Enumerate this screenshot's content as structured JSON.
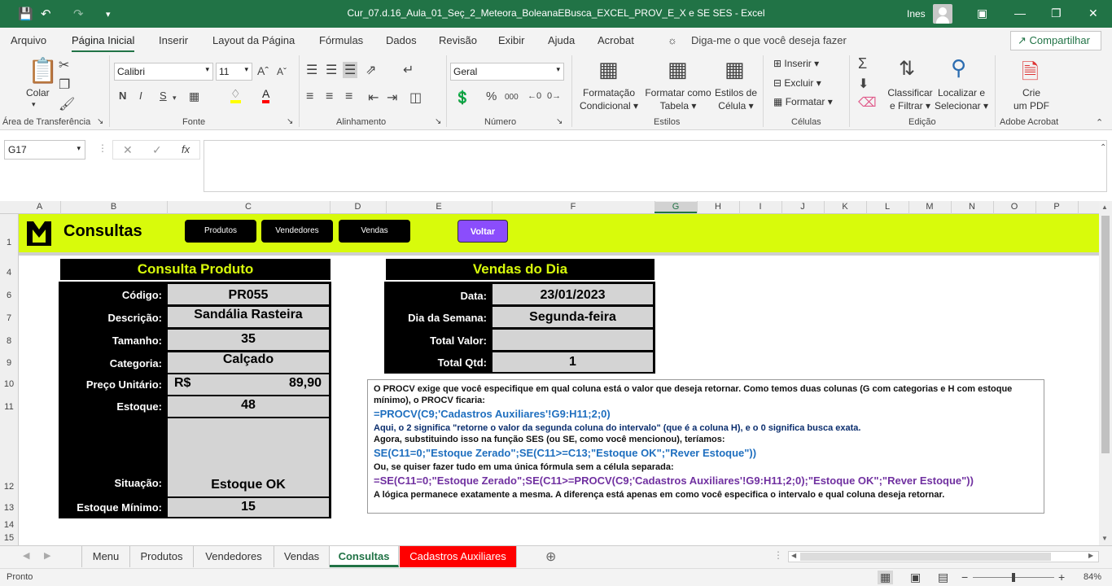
{
  "titlebar": {
    "filename": "Cur_07.d.16_Aula_01_Seç_2_Meteora_BoleanaEBusca_EXCEL_PROV_E_X e SE SES",
    "app": "Excel",
    "user": "Ines"
  },
  "menu": {
    "tabs": [
      "Arquivo",
      "Página Inicial",
      "Inserir",
      "Layout da Página",
      "Fórmulas",
      "Dados",
      "Revisão",
      "Exibir",
      "Ajuda",
      "Acrobat"
    ],
    "tellme": "Diga-me o que você deseja fazer",
    "share": "Compartilhar"
  },
  "ribbon": {
    "clipboard": {
      "paste": "Colar",
      "group": "Área de Transferência"
    },
    "font": {
      "name": "Calibri",
      "size": "11",
      "bold": "N",
      "italic": "I",
      "underline": "S",
      "group": "Fonte"
    },
    "alignment": {
      "group": "Alinhamento"
    },
    "number": {
      "format": "Geral",
      "percent": "%",
      "thousands": "000",
      "group": "Número"
    },
    "styles": {
      "cond1": "Formatação",
      "cond2": "Condicional",
      "table1": "Formatar como",
      "table2": "Tabela",
      "cell1": "Estilos de",
      "cell2": "Célula",
      "group": "Estilos"
    },
    "cells": {
      "insert": "Inserir",
      "delete": "Excluir",
      "format": "Formatar",
      "group": "Células"
    },
    "editing": {
      "sort1": "Classificar",
      "sort2": "e Filtrar",
      "find1": "Localizar e",
      "find2": "Selecionar",
      "group": "Edição"
    },
    "acrobat": {
      "pdf1": "Crie",
      "pdf2": "um PDF",
      "group": "Adobe Acrobat"
    }
  },
  "formula": {
    "namebox": "G17",
    "content": ""
  },
  "columns": [
    "A",
    "B",
    "C",
    "D",
    "E",
    "F",
    "G",
    "H",
    "I",
    "J",
    "K",
    "L",
    "M",
    "N",
    "O",
    "P"
  ],
  "rows": [
    "1",
    "4",
    "6",
    "7",
    "8",
    "9",
    "10",
    "11",
    "12",
    "13",
    "14",
    "15"
  ],
  "banner": {
    "title": "Consultas",
    "buttons": [
      "Produtos",
      "Vendedores",
      "Vendas"
    ],
    "back": "Voltar"
  },
  "produto": {
    "header": "Consulta Produto",
    "codigo_lbl": "Código:",
    "codigo": "PR055",
    "desc_lbl": "Descrição:",
    "desc": "Sandália Rasteira",
    "tam_lbl": "Tamanho:",
    "tam": "35",
    "cat_lbl": "Categoria:",
    "cat": "Calçado",
    "preco_lbl": "Preço Unitário:",
    "preco_cur": "R$",
    "preco": "89,90",
    "estoque_lbl": "Estoque:",
    "estoque": "48",
    "situacao_lbl": "Situação:",
    "situacao": "Estoque OK",
    "minimo_lbl": "Estoque Mínimo:",
    "minimo": "15"
  },
  "vendas": {
    "header": "Vendas do Dia",
    "data_lbl": "Data:",
    "data": "23/01/2023",
    "dia_lbl": "Dia da Semana:",
    "dia": "Segunda-feira",
    "valor_lbl": "Total Valor:",
    "valor": "",
    "qtd_lbl": "Total Qtd:",
    "qtd": "1"
  },
  "note": {
    "p1": "O PROCV exige que você especifique em qual coluna está o valor que deseja retornar. Como temos duas colunas (G com categorias e H com estoque mínimo), o PROCV ficaria:",
    "f1": "=PROCV(C9;'Cadastros Auxiliares'!G9:H11;2;0)",
    "p2": "Aqui, o 2 significa \"retorne o valor da segunda coluna do intervalo\" (que é a coluna H), e o 0 significa busca exata.",
    "p3": "Agora, substituindo isso na função SES (ou SE, como você mencionou), teríamos:",
    "f2": "SE(C11=0;\"Estoque Zerado\";SE(C11>=C13;\"Estoque OK\";\"Rever Estoque\"))",
    "p4": "Ou, se quiser fazer tudo em uma única fórmula sem a célula separada:",
    "f3": "=SE(C11=0;\"Estoque Zerado\";SE(C11>=PROCV(C9;'Cadastros Auxiliares'!G9:H11;2;0);\"Estoque OK\";\"Rever Estoque\"))",
    "p5": "A lógica permanece exatamente a mesma. A diferença está apenas em como você especifica o intervalo e qual coluna deseja retornar."
  },
  "sheets": [
    "Menu",
    "Produtos",
    "Vendedores",
    "Vendas",
    "Consultas",
    "Cadastros Auxiliares"
  ],
  "status": {
    "ready": "Pronto",
    "zoom": "84%"
  },
  "colors": {
    "excel_green": "#217346",
    "banner": "#d8fb0b",
    "voltar": "#8b4dfc",
    "red_tab": "#ff0000"
  }
}
